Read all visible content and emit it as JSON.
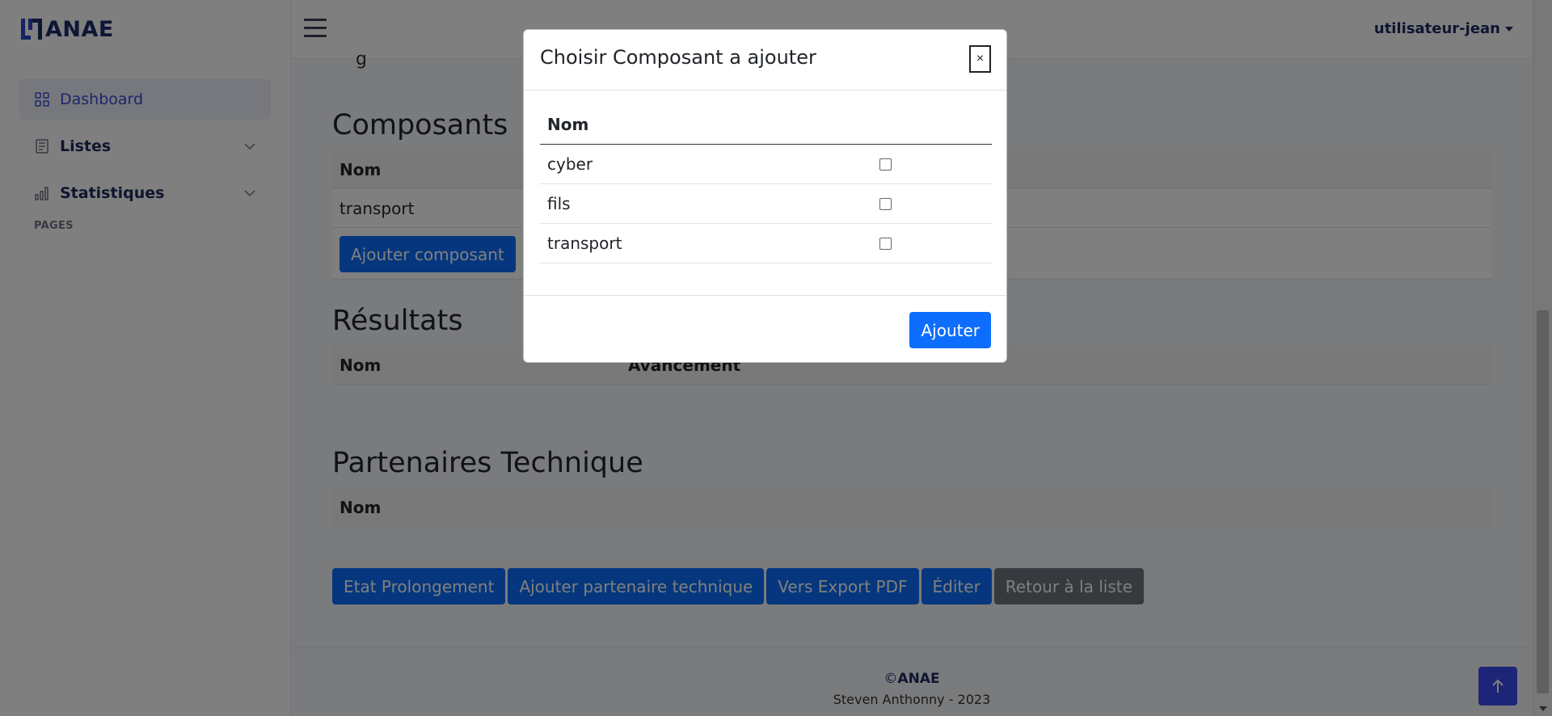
{
  "brand": {
    "name": "ANAE"
  },
  "sidebar": {
    "items": [
      {
        "label": "Dashboard",
        "icon": "grid-icon"
      },
      {
        "label": "Listes",
        "icon": "list-doc-icon"
      },
      {
        "label": "Statistiques",
        "icon": "bar-chart-icon"
      }
    ],
    "section_label": "PAGES"
  },
  "topbar": {
    "user": "utilisateur-jean"
  },
  "main": {
    "partial_text": "g",
    "composants": {
      "title": "Composants",
      "header": "Nom",
      "rows": [
        "transport"
      ],
      "add_button": "Ajouter composant"
    },
    "resultats": {
      "title": "Résultats",
      "headers": [
        "Nom",
        "Avancement"
      ]
    },
    "partenaires": {
      "title": "Partenaires Technique",
      "header": "Nom"
    },
    "actions": {
      "etat": "Etat Prolongement",
      "ajouter_partenaire": "Ajouter partenaire technique",
      "export": "Vers Export PDF",
      "editer": "Éditer",
      "retour": "Retour à la liste"
    }
  },
  "footer": {
    "copyright_symbol": "©",
    "copyright_name": "ANAE",
    "author": "Steven Anthonny - 2023"
  },
  "modal": {
    "title": "Choisir Composant a ajouter",
    "close": "×",
    "column": "Nom",
    "rows": [
      {
        "name": "cyber",
        "checked": false
      },
      {
        "name": "fils",
        "checked": false
      },
      {
        "name": "transport",
        "checked": false
      }
    ],
    "submit": "Ajouter"
  },
  "colors": {
    "primary": "#0d6efd",
    "secondary": "#6c757d",
    "brand": "#1f2a6b",
    "accent": "#3a4bf0"
  }
}
